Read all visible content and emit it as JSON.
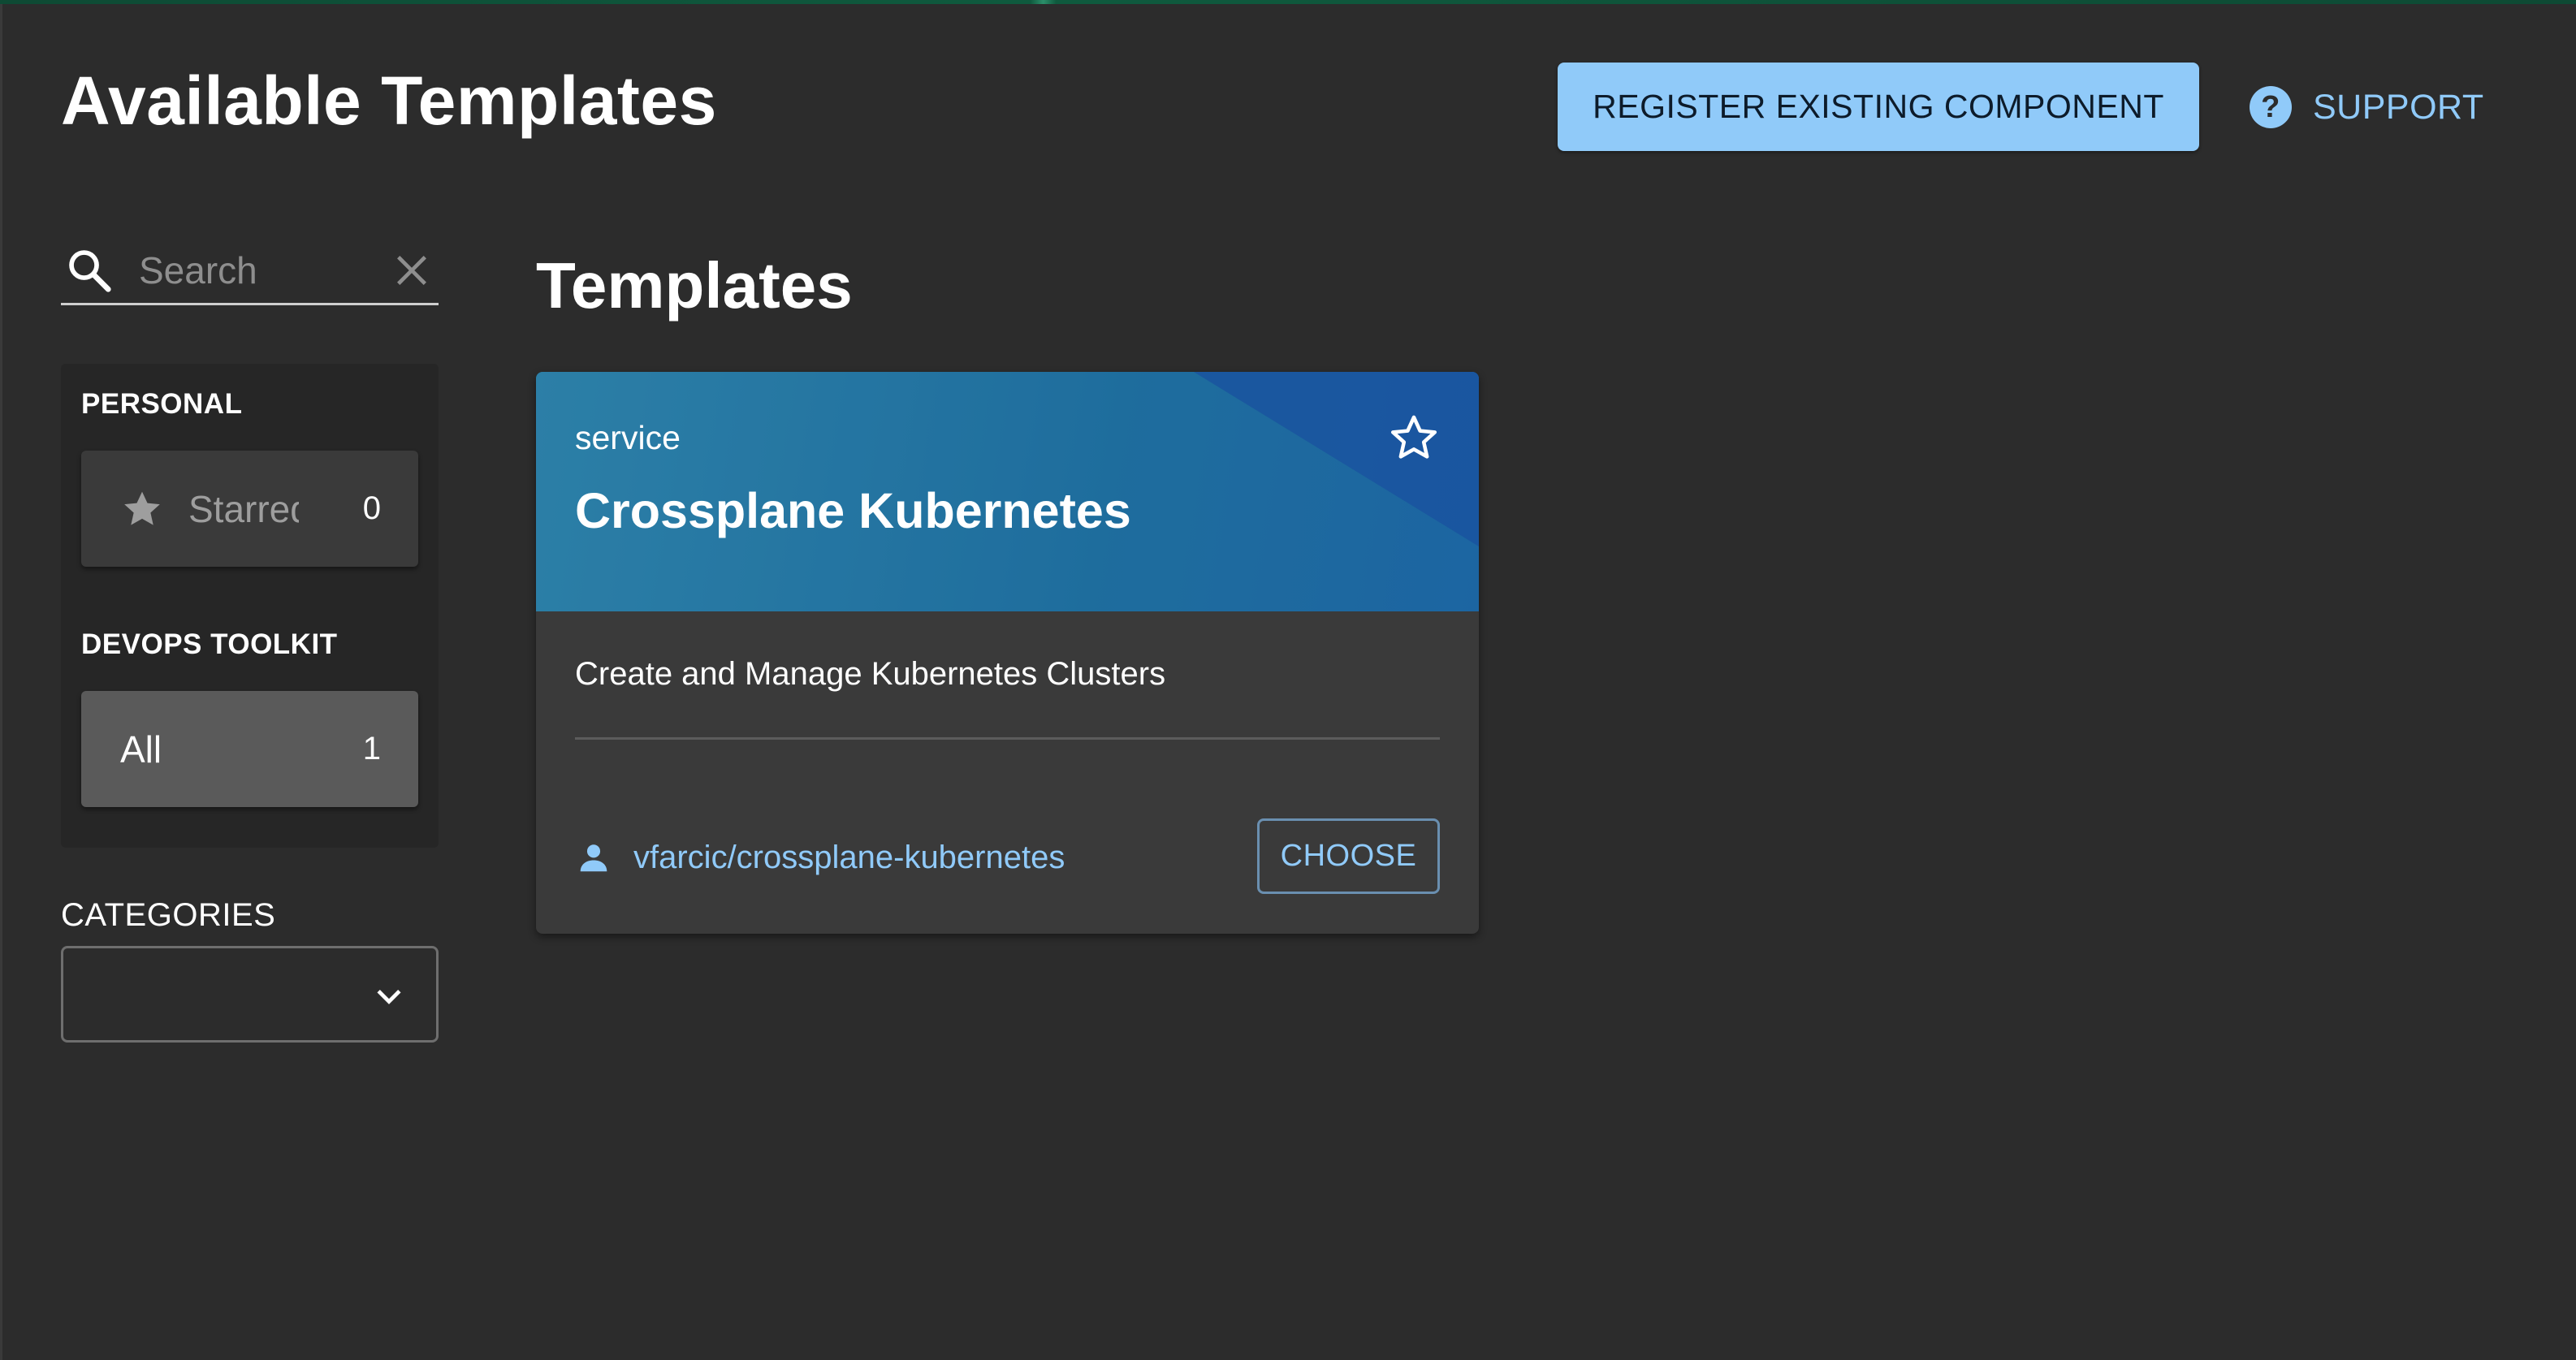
{
  "header": {
    "title": "Available Templates",
    "register_label": "REGISTER EXISTING COMPONENT",
    "support_label": "SUPPORT"
  },
  "sidebar": {
    "search": {
      "placeholder": "Search",
      "value": ""
    },
    "groups": [
      {
        "title": "PERSONAL",
        "items": [
          {
            "label": "Starred",
            "count": "0",
            "icon": "star-icon"
          }
        ]
      },
      {
        "title": "DEVOPS TOOLKIT",
        "items": [
          {
            "label": "All",
            "count": "1",
            "selected": true
          }
        ]
      }
    ],
    "categories_label": "CATEGORIES",
    "categories_value": ""
  },
  "main": {
    "section_title": "Templates",
    "cards": [
      {
        "type": "service",
        "title": "Crossplane Kubernetes",
        "description": "Create and Manage Kubernetes Clusters",
        "owner": "vfarcic/crossplane-kubernetes",
        "choose_label": "CHOOSE"
      }
    ]
  },
  "colors": {
    "background": "#2c2c2c",
    "accent": "#90caf9",
    "card_header": "#1d6a9a",
    "panel": "#262626"
  }
}
